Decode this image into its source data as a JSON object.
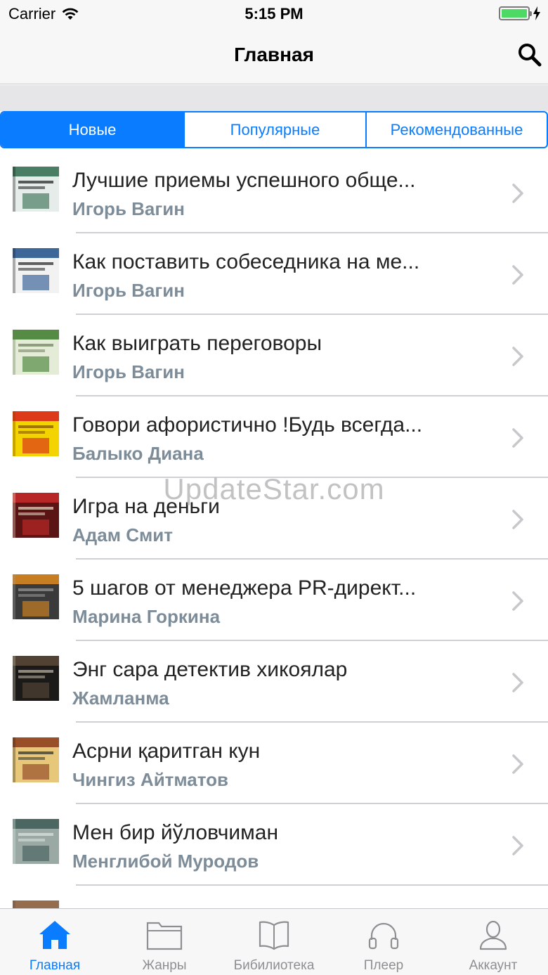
{
  "status_bar": {
    "carrier": "Carrier",
    "time": "5:15 PM",
    "battery_level": 1.0,
    "charging": true
  },
  "nav": {
    "title": "Главная",
    "search_icon": "search-icon"
  },
  "segments": [
    {
      "label": "Новые",
      "active": true
    },
    {
      "label": "Популярные",
      "active": false
    },
    {
      "label": "Рекомендованные",
      "active": false
    }
  ],
  "items": [
    {
      "title": "Лучшие приемы успешного обще...",
      "author": "Игорь Вагин",
      "cover_palette": [
        "#e6ece9",
        "#2e6b4c",
        "#1a1a1a"
      ]
    },
    {
      "title": "Как поставить собеседника на ме...",
      "author": "Игорь Вагин",
      "cover_palette": [
        "#f2f2f2",
        "#1f4f8a",
        "#222222"
      ]
    },
    {
      "title": "Как выиграть переговоры",
      "author": "Игорь Вагин",
      "cover_palette": [
        "#e4ecd8",
        "#3c7a2c",
        "#6b7d5a"
      ]
    },
    {
      "title": "Говори афористично !Будь всегда...",
      "author": "Балыко Диана",
      "cover_palette": [
        "#f3d400",
        "#d81e1e",
        "#7a4b00"
      ]
    },
    {
      "title": "Игра на деньги",
      "author": "Адам Смит",
      "cover_palette": [
        "#5a1414",
        "#c82a2a",
        "#e8e0c8"
      ]
    },
    {
      "title": "5 шагов от менеджера PR-директ...",
      "author": "Марина Горкина",
      "cover_palette": [
        "#3a3a3a",
        "#e08a1e",
        "#9a9a9a"
      ]
    },
    {
      "title": "Энг сара детектив хикоялар",
      "author": "Жамланма",
      "cover_palette": [
        "#1c1a18",
        "#5a4a3a",
        "#bfb6a6"
      ]
    },
    {
      "title": "Асрни қаритган кун",
      "author": "Чингиз Айтматов",
      "cover_palette": [
        "#e7c87a",
        "#8a3a1a",
        "#2a2a2a"
      ]
    },
    {
      "title": "Мен бир йўловчиман",
      "author": "Менглибой Муродов",
      "cover_palette": [
        "#9aa9a3",
        "#3e5a56",
        "#dfe6e3"
      ]
    },
    {
      "title": "",
      "author": "",
      "cover_palette": [
        "#d8d0c0",
        "#8a5a3a",
        "#555555"
      ]
    }
  ],
  "watermark": "UpdateStar.com",
  "tabs": [
    {
      "label": "Главная",
      "icon": "home-icon",
      "active": true
    },
    {
      "label": "Жанры",
      "icon": "folder-icon",
      "active": false
    },
    {
      "label": "Бибилиотека",
      "icon": "book-icon",
      "active": false
    },
    {
      "label": "Плеер",
      "icon": "headphones-icon",
      "active": false
    },
    {
      "label": "Аккаунт",
      "icon": "user-icon",
      "active": false
    }
  ],
  "colors": {
    "accent": "#0a7cff",
    "secondary_text": "#7d8c99",
    "tab_inactive": "#8e8e93"
  }
}
